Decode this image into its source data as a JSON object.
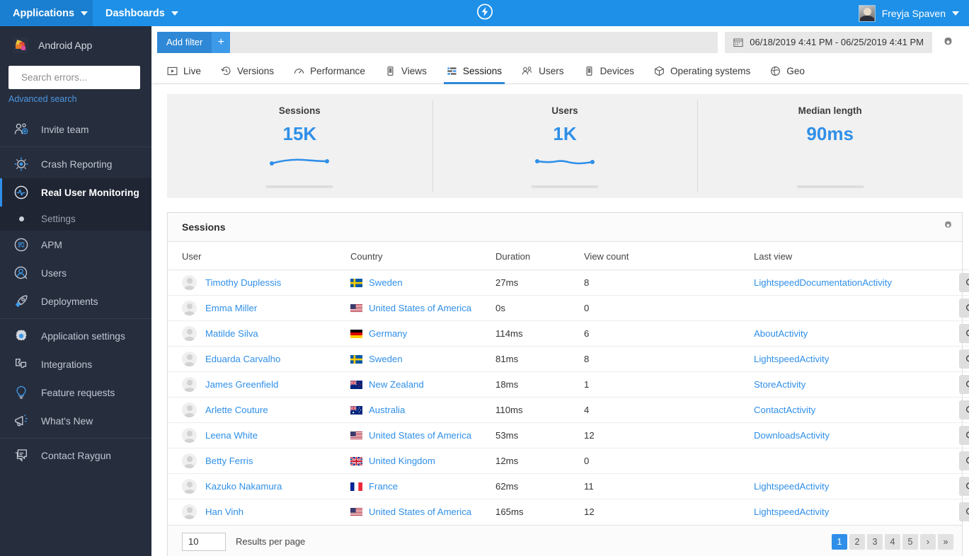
{
  "topbar": {
    "applications_label": "Applications",
    "dashboards_label": "Dashboards",
    "logo_icon": "lightning-bolt-circle-icon",
    "user_name": "Freyja Spaven"
  },
  "sidebar": {
    "app_name": "Android App",
    "search_placeholder": "Search errors...",
    "search_value": "",
    "advanced_search_label": "Advanced search",
    "groups": [
      {
        "items": [
          {
            "label": "Invite team",
            "icon": "invite-team-icon",
            "active": false
          }
        ]
      },
      {
        "items": [
          {
            "label": "Crash Reporting",
            "icon": "crash-reporting-icon",
            "active": false
          },
          {
            "label": "Real User Monitoring",
            "icon": "real-user-monitoring-icon",
            "active": true
          },
          {
            "label": "Settings",
            "icon": "bullet-dot-icon",
            "sub": true
          },
          {
            "label": "APM",
            "icon": "apm-icon",
            "active": false
          },
          {
            "label": "Users",
            "icon": "users-icon",
            "active": false
          },
          {
            "label": "Deployments",
            "icon": "deployments-rocket-icon",
            "active": false
          }
        ]
      },
      {
        "items": [
          {
            "label": "Application settings",
            "icon": "gear-icon",
            "active": false
          },
          {
            "label": "Integrations",
            "icon": "integrations-puzzle-icon",
            "active": false
          },
          {
            "label": "Feature requests",
            "icon": "lightbulb-icon",
            "active": false
          },
          {
            "label": "What's New",
            "icon": "megaphone-icon",
            "active": false
          }
        ]
      },
      {
        "items": [
          {
            "label": "Contact Raygun",
            "icon": "chat-bubble-icon",
            "active": false
          }
        ]
      }
    ]
  },
  "filterbar": {
    "add_filter_label": "Add filter",
    "plus_label": "+",
    "date_range": "06/18/2019 4:41 PM - 06/25/2019 4:41 PM",
    "calendar_icon": "calendar-icon",
    "settings_icon": "gear-icon"
  },
  "tabs": [
    {
      "label": "Live",
      "icon": "play-box-icon",
      "active": false
    },
    {
      "label": "Versions",
      "icon": "history-clock-icon",
      "active": false
    },
    {
      "label": "Performance",
      "icon": "gauge-icon",
      "active": false
    },
    {
      "label": "Views",
      "icon": "device-icon",
      "active": false
    },
    {
      "label": "Sessions",
      "icon": "sessions-bars-icon",
      "active": true
    },
    {
      "label": "Users",
      "icon": "users-group-icon",
      "active": false
    },
    {
      "label": "Devices",
      "icon": "device-icon",
      "active": false
    },
    {
      "label": "Operating systems",
      "icon": "cube-icon",
      "active": false
    },
    {
      "label": "Geo",
      "icon": "globe-icon",
      "active": false
    }
  ],
  "stats": [
    {
      "label": "Sessions",
      "value": "15K",
      "has_sparkline": true
    },
    {
      "label": "Users",
      "value": "1K",
      "has_sparkline": true
    },
    {
      "label": "Median length",
      "value": "90ms",
      "has_sparkline": false
    }
  ],
  "panel": {
    "title": "Sessions",
    "settings_icon": "gear-icon",
    "columns": [
      "User",
      "Country",
      "Duration",
      "View count",
      "Last view"
    ],
    "rows": [
      {
        "user": "Timothy Duplessis",
        "country": "Sweden",
        "flag": "se",
        "duration": "27ms",
        "views": "8",
        "last_view": "LightspeedDocumentationActivity"
      },
      {
        "user": "Emma Miller",
        "country": "United States of America",
        "flag": "us",
        "duration": "0s",
        "views": "0",
        "last_view": ""
      },
      {
        "user": "Matilde Silva",
        "country": "Germany",
        "flag": "de",
        "duration": "114ms",
        "views": "6",
        "last_view": "AboutActivity"
      },
      {
        "user": "Eduarda Carvalho",
        "country": "Sweden",
        "flag": "se",
        "duration": "81ms",
        "views": "8",
        "last_view": "LightspeedActivity"
      },
      {
        "user": "James Greenfield",
        "country": "New Zealand",
        "flag": "nz",
        "duration": "18ms",
        "views": "1",
        "last_view": "StoreActivity"
      },
      {
        "user": "Arlette Couture",
        "country": "Australia",
        "flag": "au",
        "duration": "110ms",
        "views": "4",
        "last_view": "ContactActivity"
      },
      {
        "user": "Leena White",
        "country": "United States of America",
        "flag": "us",
        "duration": "53ms",
        "views": "12",
        "last_view": "DownloadsActivity"
      },
      {
        "user": "Betty Ferris",
        "country": "United Kingdom",
        "flag": "gb",
        "duration": "12ms",
        "views": "0",
        "last_view": ""
      },
      {
        "user": "Kazuko Nakamura",
        "country": "France",
        "flag": "fr",
        "duration": "62ms",
        "views": "11",
        "last_view": "LightspeedActivity"
      },
      {
        "user": "Han Vinh",
        "country": "United States of America",
        "flag": "us",
        "duration": "165ms",
        "views": "12",
        "last_view": "LightspeedActivity"
      }
    ],
    "row_action_icon": "magnifier-icon"
  },
  "footer": {
    "results_per_page_value": "10",
    "results_per_page_label": "Results per page",
    "pages": [
      "1",
      "2",
      "3",
      "4",
      "5"
    ],
    "active_page": "1",
    "next_label": "›",
    "last_label": "»"
  },
  "colors": {
    "brand_blue": "#2f8fe8",
    "topbar_blue": "#1e90e8",
    "sidebar_dark": "#262d3d",
    "link_blue": "#2f8fe8"
  }
}
